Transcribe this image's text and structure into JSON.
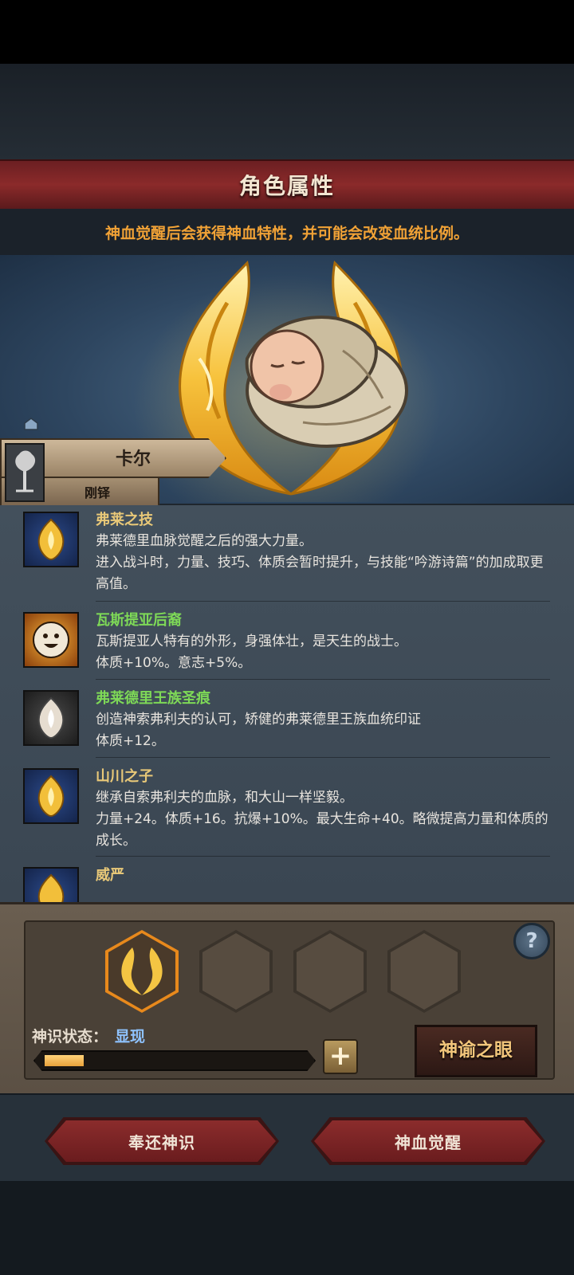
{
  "header": {
    "title": "角色属性"
  },
  "notice": "神血觉醒后会获得神血特性，并可能会改变血统比例。",
  "character": {
    "name": "卡尔",
    "sub_label": "刚铎"
  },
  "traits": [
    {
      "name": "弗莱之技",
      "name_color": "#e8c878",
      "icon": "golden-flame-crest-icon",
      "lines": [
        "弗莱德里血脉觉醒之后的强大力量。",
        "进入战斗时，力量、技巧、体质会暂时提升，与技能“吟游诗篇”的加成取更高值。"
      ]
    },
    {
      "name": "瓦斯提亚后裔",
      "name_color": "#7ed957",
      "icon": "smiling-sun-face-icon",
      "lines": [
        "瓦斯提亚人特有的外形，身强体壮，是天生的战士。",
        "体质+10%。意志+5%。"
      ]
    },
    {
      "name": "弗莱德里王族圣痕",
      "name_color": "#7ed957",
      "icon": "silver-flame-crest-icon",
      "lines": [
        "创造神索弗利夫的认可，矫健的弗莱德里王族血统印证",
        "体质+12。"
      ]
    },
    {
      "name": "山川之子",
      "name_color": "#e8c878",
      "icon": "golden-flame-crest-icon",
      "lines": [
        "继承自索弗利夫的血脉，和大山一样坚毅。",
        "力量+24。体质+16。抗爆+10%。最大生命+40。略微提高力量和体质的成长。"
      ]
    },
    {
      "name": "威严",
      "name_color": "#e8c878",
      "icon": "golden-flame-crest-icon",
      "lines": [
        ""
      ]
    }
  ],
  "divine": {
    "status_label": "神识状态：",
    "status_value": "显现",
    "progress": 0.15,
    "plus_label": "+",
    "help_label": "?",
    "oracle_button": "神谕之眼"
  },
  "buttons": {
    "return": "奉还神识",
    "awaken": "神血觉醒"
  },
  "colors": {
    "accent": "#f1a236",
    "title_red": "#8b2a2a",
    "status_blue": "#8fc3ff"
  }
}
